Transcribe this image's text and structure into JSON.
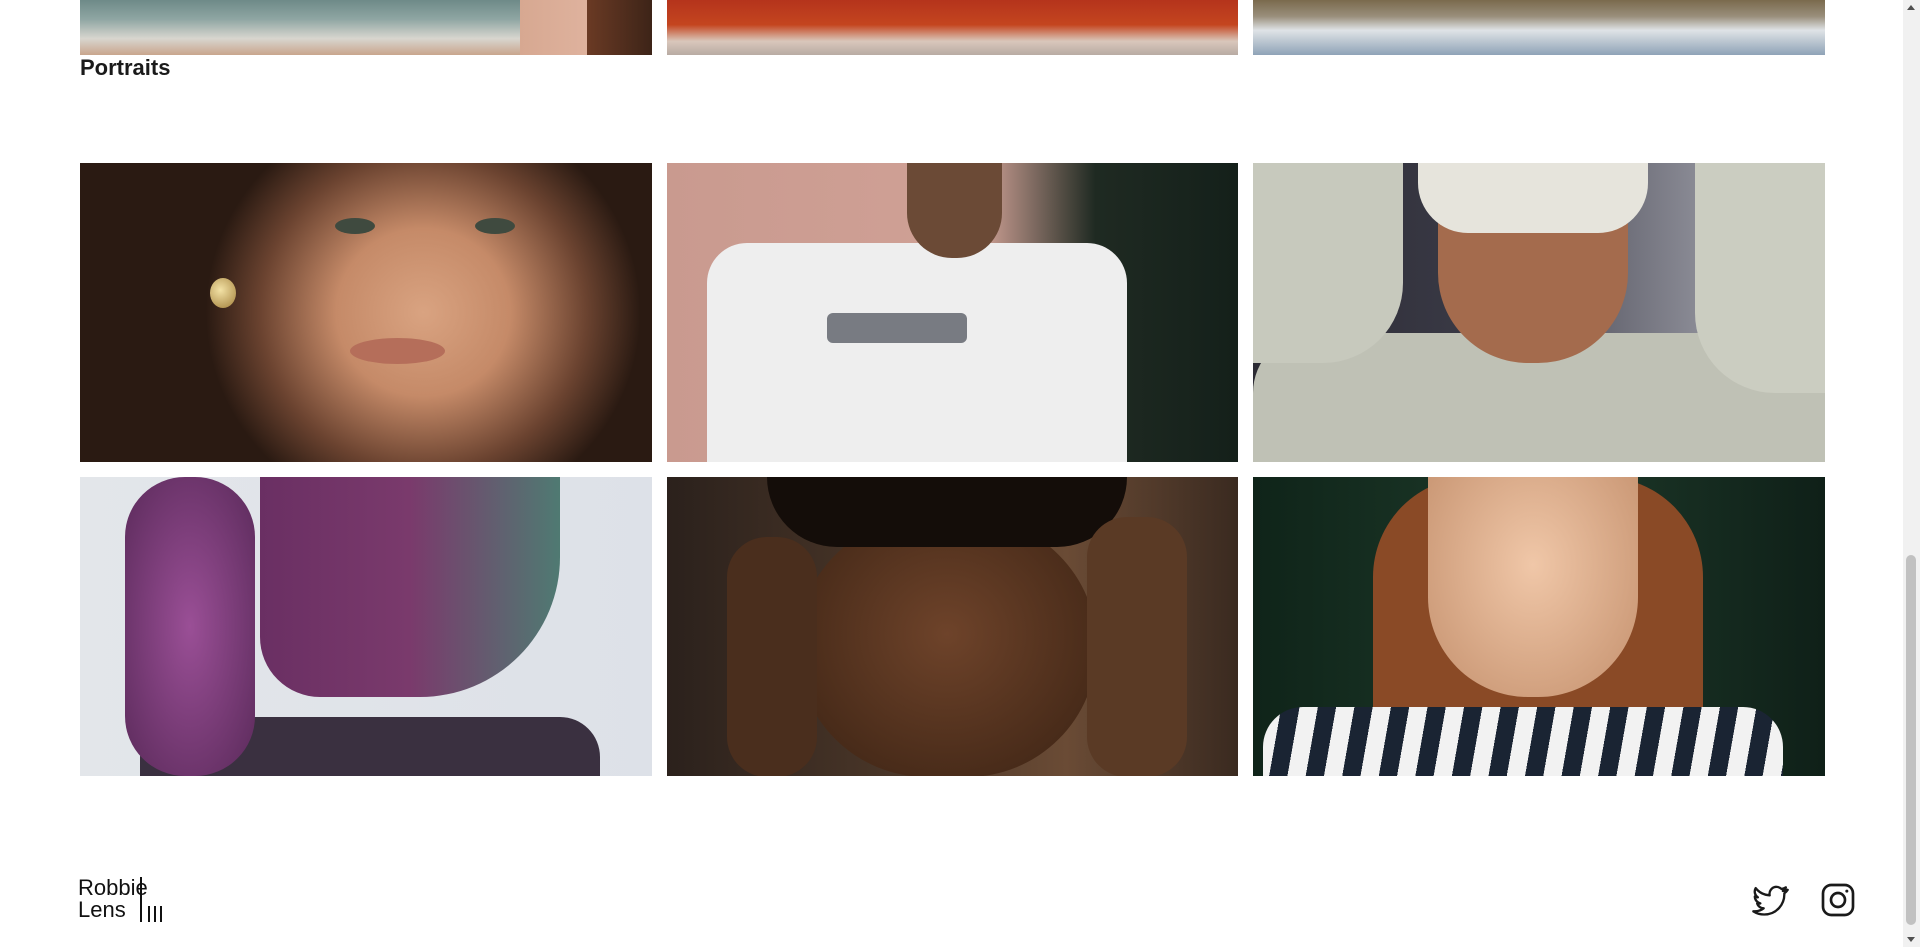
{
  "gallery": {
    "landscapes_partial": [
      {
        "name": "sea-cliffs"
      },
      {
        "name": "red-salt-flats"
      },
      {
        "name": "mountain-lake"
      }
    ],
    "section_title": "Portraits",
    "portraits": [
      {
        "name": "woman-freckles"
      },
      {
        "name": "white-tshirt"
      },
      {
        "name": "man-hoodie"
      },
      {
        "name": "purple-hair"
      },
      {
        "name": "locs-hands"
      },
      {
        "name": "redhead-stripes"
      }
    ]
  },
  "footer": {
    "logo_line1": "Robbie",
    "logo_line2": "Lens",
    "social": [
      {
        "icon": "twitter-icon"
      },
      {
        "icon": "instagram-icon"
      }
    ]
  }
}
